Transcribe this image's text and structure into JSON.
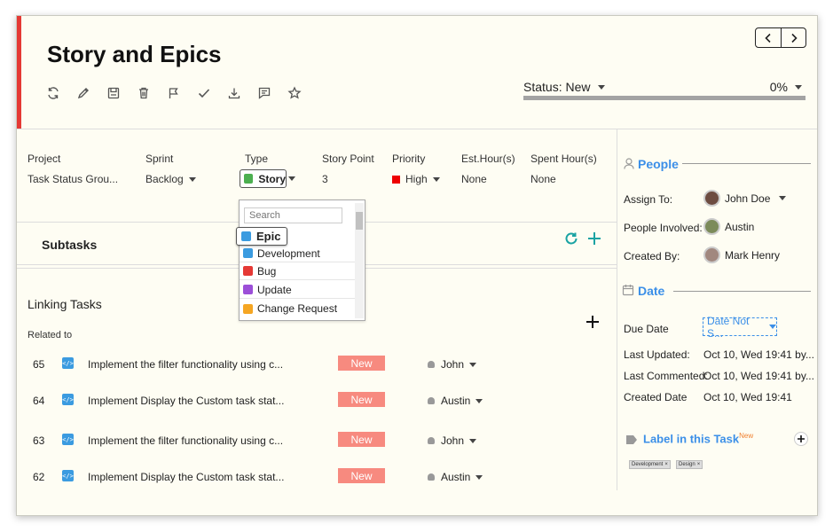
{
  "title": "Story and Epics",
  "status": {
    "label": "Status: New",
    "percent_label": "0%",
    "progress": 0
  },
  "fields": {
    "project": {
      "label": "Project",
      "value": "Task Status Grou..."
    },
    "sprint": {
      "label": "Sprint",
      "value": "Backlog"
    },
    "type": {
      "label": "Type",
      "value": "Story"
    },
    "story_point": {
      "label": "Story Point",
      "value": "3"
    },
    "priority": {
      "label": "Priority",
      "value": "High",
      "color": "#ee0000"
    },
    "est_hours": {
      "label": "Est.Hour(s)",
      "value": "None"
    },
    "spent_hours": {
      "label": "Spent Hour(s)",
      "value": "None"
    }
  },
  "type_dropdown": {
    "search_placeholder": "Search",
    "highlighted": "Epic",
    "items": [
      {
        "label": "Development",
        "icon": "development-icon",
        "color": "#3b9be0"
      },
      {
        "label": "Bug",
        "icon": "bug-icon",
        "color": "#e53935"
      },
      {
        "label": "Update",
        "icon": "update-icon",
        "color": "#9c4fd8"
      },
      {
        "label": "Change Request",
        "icon": "change-request-icon",
        "color": "#f5a623"
      }
    ]
  },
  "subtasks": {
    "title": "Subtasks"
  },
  "linking": {
    "title": "Linking Tasks",
    "related_label": "Related to",
    "rows": [
      {
        "id": "65",
        "title": "Implement the filter functionality using c...",
        "status": "New",
        "assignee": "John"
      },
      {
        "id": "64",
        "title": "Implement Display the Custom task stat...",
        "status": "New",
        "assignee": "Austin"
      },
      {
        "id": "63",
        "title": "Implement the filter functionality using c...",
        "status": "New",
        "assignee": "John"
      },
      {
        "id": "62",
        "title": "Implement Display the Custom task stat...",
        "status": "New",
        "assignee": "Austin"
      }
    ]
  },
  "people": {
    "title": "People",
    "assign_label": "Assign To:",
    "assign_value": "John Doe",
    "involved_label": "People Involved:",
    "involved_value": "Austin",
    "created_by_label": "Created By:",
    "created_by_value": "Mark Henry"
  },
  "date": {
    "title": "Date",
    "due_label": "Due Date",
    "due_value": "Date Not S...",
    "updated_label": "Last Updated:",
    "updated_value": "Oct 10, Wed 19:41 by...",
    "commented_label": "Last Commented:",
    "commented_value": "Oct 10, Wed 19:41 by...",
    "created_label": "Created Date",
    "created_value": "Oct 10, Wed 19:41"
  },
  "labels": {
    "title": "Label in this Task",
    "new_badge": "New",
    "tags": [
      "Development",
      "Design"
    ]
  },
  "colors": {
    "accent": "#e53935",
    "link_blue": "#3b8fe8",
    "status_new": "#f78a7f",
    "teal": "#1aa3a3"
  }
}
